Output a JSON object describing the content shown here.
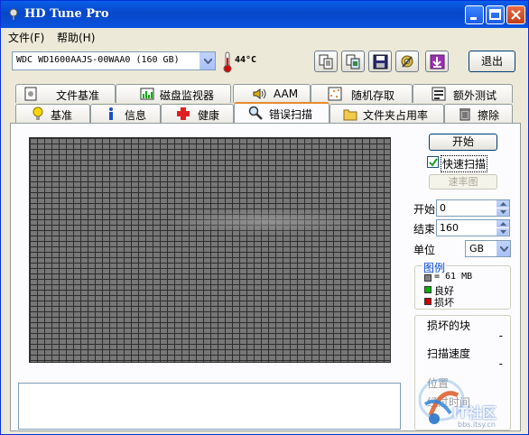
{
  "app": {
    "title": "HD Tune Pro"
  },
  "window_buttons": {
    "minimize": "minimize-icon",
    "maximize": "maximize-icon",
    "close": "close-icon"
  },
  "menu": {
    "file": "文件(F)",
    "help": "帮助(H)"
  },
  "toolbar": {
    "drive": "WDC WD1600AAJS-00WAA0 (160 GB)",
    "temperature": "44°C",
    "exit_label": "退出",
    "icons": [
      "copy-text-icon",
      "copy-screenshot-icon",
      "save-icon",
      "settings-icon",
      "download-icon"
    ]
  },
  "tabs": {
    "row1": [
      "文件基准",
      "磁盘监视器",
      "AAM",
      "随机存取",
      "额外测试"
    ],
    "row2": [
      "基准",
      "信息",
      "健康",
      "错误扫描",
      "文件夹占用率",
      "擦除"
    ],
    "active": "错误扫描"
  },
  "scan": {
    "start_label": "开始",
    "quick_scan_label": "快速扫描",
    "quick_scan_checked": true,
    "rate_map_label": "速率图",
    "start_field_label": "开始",
    "start_value": "0",
    "end_field_label": "结束",
    "end_value": "160",
    "unit_label": "单位",
    "unit_value": "GB"
  },
  "legend": {
    "title": "图例",
    "block_size": "= 61 MB",
    "good": "良好",
    "damaged": "损坏",
    "colors": {
      "block": "#808080",
      "good": "#00b000",
      "damaged": "#d00000"
    }
  },
  "stats": {
    "damaged_blocks_label": "损坏的块",
    "damaged_blocks_value": "-",
    "scan_speed_label": "扫描速度",
    "scan_speed_value": "-",
    "position_label": "位置",
    "elapsed_label": "经过时间"
  },
  "watermark": {
    "text": "IT社区",
    "url": "bbs.itsy.cn"
  }
}
